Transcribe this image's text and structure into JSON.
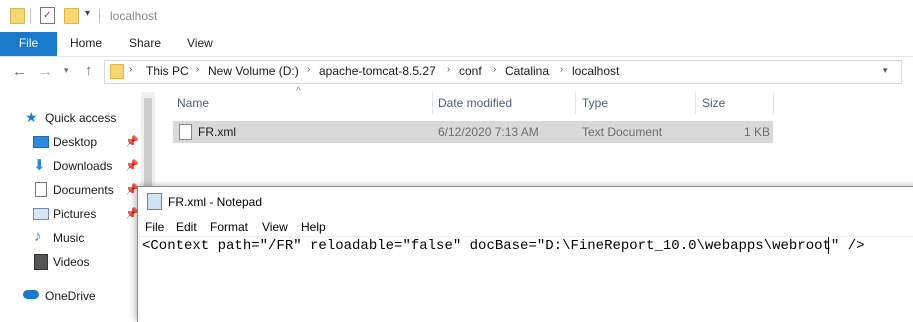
{
  "window": {
    "title": "localhost"
  },
  "ribbon": {
    "tabs": [
      "File",
      "Home",
      "Share",
      "View"
    ]
  },
  "address": {
    "crumbs": [
      "This PC",
      "New Volume (D:)",
      "apache-tomcat-8.5.27",
      "conf",
      "Catalina",
      "localhost"
    ]
  },
  "nav": {
    "quick_access": "Quick access",
    "items": [
      {
        "label": "Desktop",
        "icon": "desktop-icon",
        "pinned": true
      },
      {
        "label": "Downloads",
        "icon": "downloads-icon",
        "pinned": true
      },
      {
        "label": "Documents",
        "icon": "documents-icon",
        "pinned": true
      },
      {
        "label": "Pictures",
        "icon": "pictures-icon",
        "pinned": true
      },
      {
        "label": "Music",
        "icon": "music-icon",
        "pinned": false
      },
      {
        "label": "Videos",
        "icon": "videos-icon",
        "pinned": false
      }
    ],
    "onedrive": "OneDrive"
  },
  "files": {
    "columns": [
      "Name",
      "Date modified",
      "Type",
      "Size"
    ],
    "rows": [
      {
        "name": "FR.xml",
        "date": "6/12/2020 7:13 AM",
        "type": "Text Document",
        "size": "1 KB"
      }
    ]
  },
  "notepad": {
    "title": "FR.xml - Notepad",
    "menu": [
      "File",
      "Edit",
      "Format",
      "View",
      "Help"
    ],
    "content": "<Context path=\"/FR\" reloadable=\"false\" docBase=\"D:\\FineReport_10.0\\webapps\\webroot\" />"
  },
  "colors": {
    "accent": "#1979ca",
    "selected_row": "#d9d9d9"
  }
}
